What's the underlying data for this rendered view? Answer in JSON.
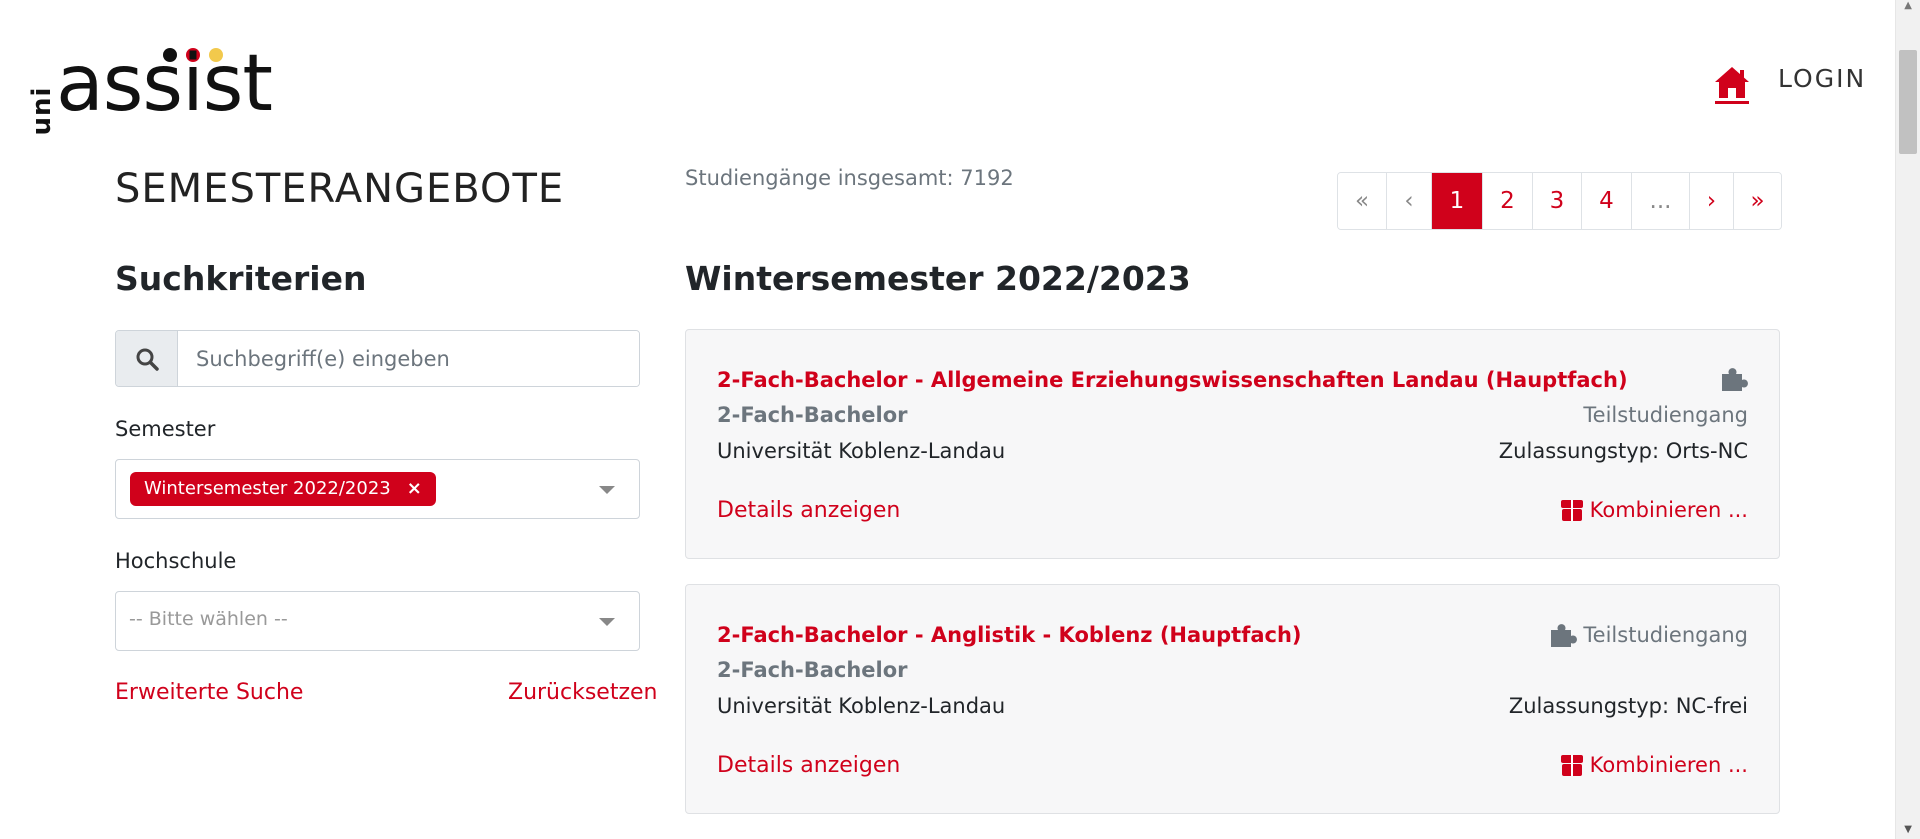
{
  "header": {
    "logo_uni": "uni",
    "logo_word": "assist",
    "logo_icon": "uni-assist-logo",
    "home_icon": "home-icon",
    "login_label": "LOGIN"
  },
  "colors": {
    "accent": "#d0011b",
    "dot_black": "#111111",
    "dot_red": "#d0011b",
    "dot_gold": "#f2c94c"
  },
  "page_title": "SEMESTERANGEBOTE",
  "sidebar": {
    "title": "Suchkriterien",
    "search_icon": "search-icon",
    "search_placeholder": "Suchbegriff(e) eingeben",
    "semester_label": "Semester",
    "semester_selected": "Wintersemester 2022/2023",
    "remove_symbol": "×",
    "hochschule_label": "Hochschule",
    "hochschule_placeholder": "-- Bitte wählen --",
    "advanced_search": "Erweiterte Suche",
    "reset": "Zurücksetzen"
  },
  "results": {
    "total_text": "Studiengänge insgesamt: 7192",
    "semester_heading": "Wintersemester 2022/2023",
    "pagination": [
      "«",
      "‹",
      "1",
      "2",
      "3",
      "4",
      "...",
      "›",
      "»"
    ],
    "active_page": "1",
    "cards": [
      {
        "title": "2-Fach-Bachelor - Allgemeine Erziehungswissenschaften Landau (Hauptfach)",
        "degree": "2-Fach-Bachelor",
        "university": "Universität Koblenz-Landau",
        "type": "Teilstudiengang",
        "admission": "Zulassungstyp: Orts-NC",
        "details": "Details anzeigen",
        "combine": "Kombinieren ...",
        "type_icon": "puzzle-icon",
        "combine_icon": "box-icon"
      },
      {
        "title": "2-Fach-Bachelor - Anglistik - Koblenz (Hauptfach)",
        "degree": "2-Fach-Bachelor",
        "university": "Universität Koblenz-Landau",
        "type": "Teilstudiengang",
        "admission": "Zulassungstyp: NC-frei",
        "details": "Details anzeigen",
        "combine": "Kombinieren ...",
        "type_icon": "puzzle-icon",
        "combine_icon": "box-icon"
      }
    ]
  }
}
